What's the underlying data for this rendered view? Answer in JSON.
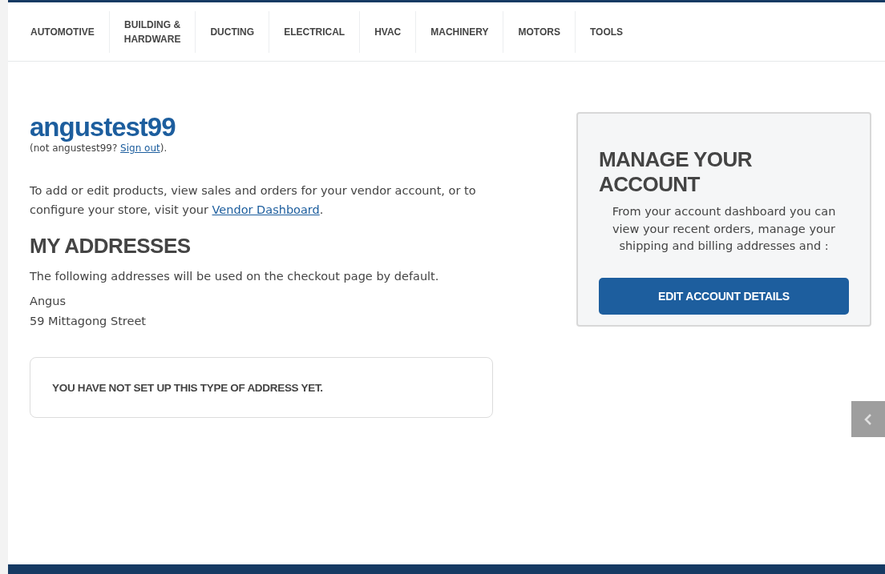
{
  "nav": {
    "items": [
      "AUTOMOTIVE",
      "BUILDING &\nHARDWARE",
      "DUCTING",
      "ELECTRICAL",
      "HVAC",
      "MACHINERY",
      "MOTORS",
      "TOOLS"
    ]
  },
  "account": {
    "username": "angustest99",
    "signout_note": {
      "before": "(not angustest99? ",
      "link": "Sign out",
      "after": ")."
    },
    "vendor_note": {
      "before": "To add or edit products, view sales and orders for your vendor account, or to configure your store, visit your ",
      "link": "Vendor Dashboard",
      "after": "."
    }
  },
  "addresses": {
    "heading": "MY ADDRESSES",
    "intro": "The following addresses will be used on the checkout page by default.",
    "lines": [
      "Angus",
      "59 Mittagong Street"
    ],
    "empty_notice": "YOU HAVE NOT SET UP THIS TYPE OF ADDRESS YET."
  },
  "manage_card": {
    "title": "MANAGE YOUR ACCOUNT",
    "text": "From your account dashboard you can view your recent orders, manage your shipping and billing addresses and :",
    "button": "EDIT ACCOUNT DETAILS"
  }
}
